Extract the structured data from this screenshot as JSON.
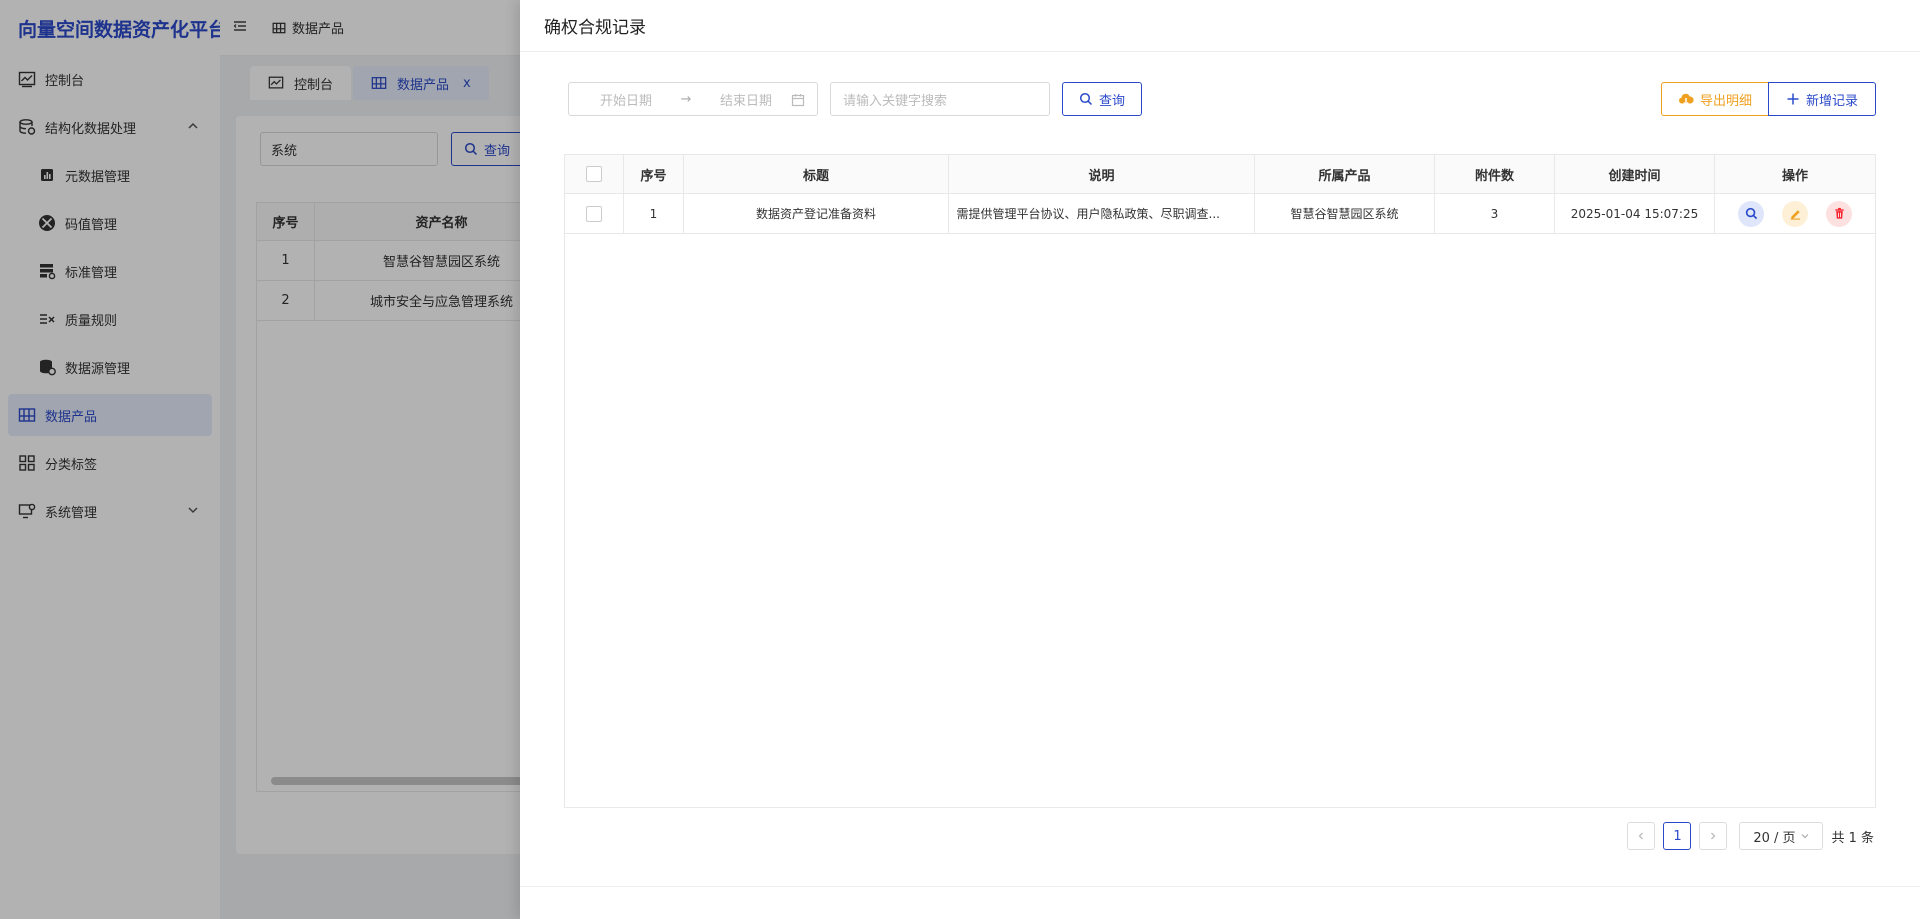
{
  "app": {
    "brand": "向量空间数据资产化平台",
    "breadcrumb": "数据产品"
  },
  "sidebar": {
    "items": [
      {
        "label": "控制台",
        "icon": "dashboard-icon"
      },
      {
        "label": "结构化数据处理",
        "icon": "database-icon"
      },
      {
        "label": "元数据管理",
        "icon": "chart-icon"
      },
      {
        "label": "码值管理",
        "icon": "code-icon"
      },
      {
        "label": "标准管理",
        "icon": "standard-icon"
      },
      {
        "label": "质量规则",
        "icon": "rule-icon"
      },
      {
        "label": "数据源管理",
        "icon": "datasource-icon"
      },
      {
        "label": "数据产品",
        "icon": "product-icon"
      },
      {
        "label": "分类标签",
        "icon": "grid-icon"
      },
      {
        "label": "系统管理",
        "icon": "settings-icon"
      }
    ]
  },
  "tabs": [
    {
      "label": "控制台"
    },
    {
      "label": "数据产品",
      "close": "x"
    }
  ],
  "background_page": {
    "search_value": "系统",
    "query_label": "查询",
    "columns": [
      "序号",
      "资产名称"
    ],
    "rows": [
      [
        "1",
        "智慧谷智慧园区系统"
      ],
      [
        "2",
        "城市安全与应急管理系统"
      ]
    ]
  },
  "drawer": {
    "title": "确权合规记录",
    "filters": {
      "start_placeholder": "开始日期",
      "end_placeholder": "结束日期",
      "arrow": "→",
      "keyword_placeholder": "请输入关键字搜索",
      "query_label": "查询"
    },
    "actions": {
      "export_label": "导出明细",
      "add_label": "新增记录"
    },
    "table": {
      "columns": [
        "序号",
        "标题",
        "说明",
        "所属产品",
        "附件数",
        "创建时间",
        "操作"
      ],
      "rows": [
        {
          "index": "1",
          "title": "数据资产登记准备资料",
          "desc": "需提供管理平台协议、用户隐私政策、尽职调查...",
          "product": "智慧谷智慧园区系统",
          "attachments": "3",
          "created": "2025-01-04 15:07:25"
        }
      ]
    },
    "pagination": {
      "current": "1",
      "page_size": "20 / 页",
      "total": "共 1 条"
    }
  },
  "colors": {
    "primary": "#2b4acb",
    "warning": "#f0a020",
    "danger": "#f5222d"
  }
}
